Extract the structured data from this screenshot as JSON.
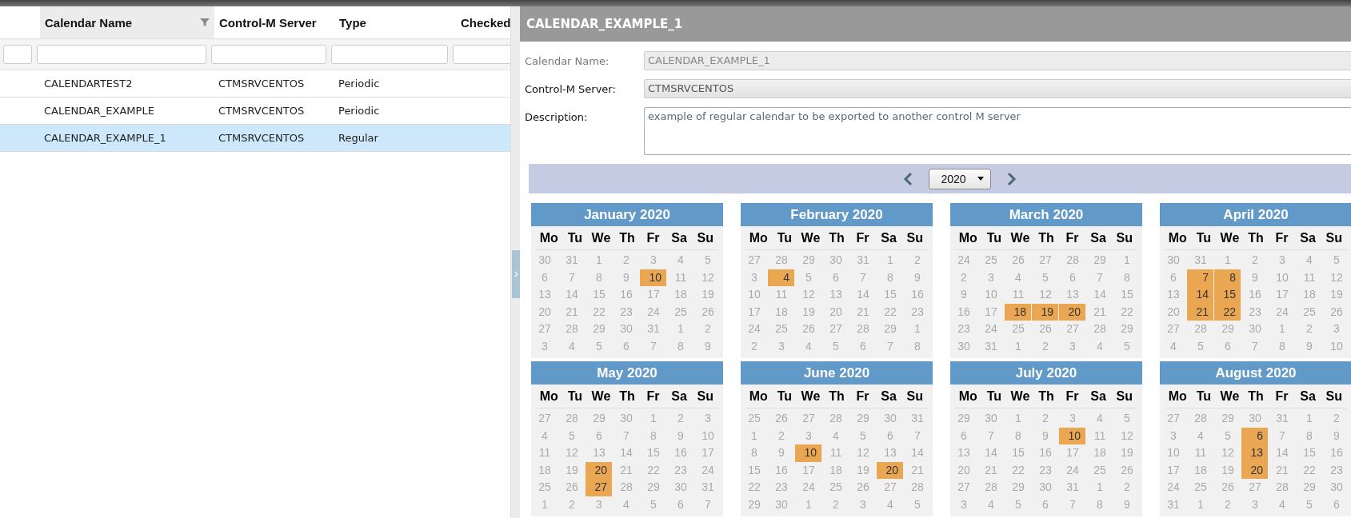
{
  "table": {
    "columns": [
      {
        "label": "Calendar Name",
        "active": true
      },
      {
        "label": "Control-M Server",
        "active": false
      },
      {
        "label": "Type",
        "active": false
      },
      {
        "label": "Checked",
        "active": false
      }
    ],
    "rows": [
      {
        "cells": [
          "CALENDARTEST2",
          "CTMSRVCENTOS",
          "Periodic"
        ],
        "selected": false
      },
      {
        "cells": [
          "CALENDAR_EXAMPLE",
          "CTMSRVCENTOS",
          "Periodic"
        ],
        "selected": false
      },
      {
        "cells": [
          "CALENDAR_EXAMPLE_1",
          "CTMSRVCENTOS",
          "Regular"
        ],
        "selected": true
      }
    ]
  },
  "details": {
    "title": "CALENDAR_EXAMPLE_1",
    "fields": [
      {
        "label": "Calendar Name:",
        "value": "CALENDAR_EXAMPLE_1",
        "kind": "disabled"
      },
      {
        "label": "Control-M Server:",
        "value": "CTMSRVCENTOS",
        "kind": "readonly"
      },
      {
        "label": "Description:",
        "value": "example of regular calendar to be exported to another control M server",
        "kind": "textarea"
      }
    ],
    "year": "2020",
    "months": [
      {
        "title": "January 2020",
        "weekdays": [
          "Mo",
          "Tu",
          "We",
          "Th",
          "Fr",
          "Sa",
          "Su"
        ],
        "days": [
          {
            "day": "30",
            "selected": false
          },
          {
            "day": "31",
            "selected": false
          },
          {
            "day": "1",
            "selected": false
          },
          {
            "day": "2",
            "selected": false
          },
          {
            "day": "3",
            "selected": false
          },
          {
            "day": "4",
            "selected": false
          },
          {
            "day": "5",
            "selected": false
          },
          {
            "day": "6",
            "selected": false
          },
          {
            "day": "7",
            "selected": false
          },
          {
            "day": "8",
            "selected": false
          },
          {
            "day": "9",
            "selected": false
          },
          {
            "day": "10",
            "selected": true
          },
          {
            "day": "11",
            "selected": false
          },
          {
            "day": "12",
            "selected": false
          },
          {
            "day": "13",
            "selected": false
          },
          {
            "day": "14",
            "selected": false
          },
          {
            "day": "15",
            "selected": false
          },
          {
            "day": "16",
            "selected": false
          },
          {
            "day": "17",
            "selected": false
          },
          {
            "day": "18",
            "selected": false
          },
          {
            "day": "19",
            "selected": false
          },
          {
            "day": "20",
            "selected": false
          },
          {
            "day": "21",
            "selected": false
          },
          {
            "day": "22",
            "selected": false
          },
          {
            "day": "23",
            "selected": false
          },
          {
            "day": "24",
            "selected": false
          },
          {
            "day": "25",
            "selected": false
          },
          {
            "day": "26",
            "selected": false
          },
          {
            "day": "27",
            "selected": false
          },
          {
            "day": "28",
            "selected": false
          },
          {
            "day": "29",
            "selected": false
          },
          {
            "day": "30",
            "selected": false
          },
          {
            "day": "31",
            "selected": false
          },
          {
            "day": "1",
            "selected": false
          },
          {
            "day": "2",
            "selected": false
          },
          {
            "day": "3",
            "selected": false
          },
          {
            "day": "4",
            "selected": false
          },
          {
            "day": "5",
            "selected": false
          },
          {
            "day": "6",
            "selected": false
          },
          {
            "day": "7",
            "selected": false
          },
          {
            "day": "8",
            "selected": false
          },
          {
            "day": "9",
            "selected": false
          }
        ]
      },
      {
        "title": "February 2020",
        "weekdays": [
          "Mo",
          "Tu",
          "We",
          "Th",
          "Fr",
          "Sa",
          "Su"
        ],
        "days": [
          {
            "day": "27",
            "selected": false
          },
          {
            "day": "28",
            "selected": false
          },
          {
            "day": "29",
            "selected": false
          },
          {
            "day": "30",
            "selected": false
          },
          {
            "day": "31",
            "selected": false
          },
          {
            "day": "1",
            "selected": false
          },
          {
            "day": "2",
            "selected": false
          },
          {
            "day": "3",
            "selected": false
          },
          {
            "day": "4",
            "selected": true
          },
          {
            "day": "5",
            "selected": false
          },
          {
            "day": "6",
            "selected": false
          },
          {
            "day": "7",
            "selected": false
          },
          {
            "day": "8",
            "selected": false
          },
          {
            "day": "9",
            "selected": false
          },
          {
            "day": "10",
            "selected": false
          },
          {
            "day": "11",
            "selected": false
          },
          {
            "day": "12",
            "selected": false
          },
          {
            "day": "13",
            "selected": false
          },
          {
            "day": "14",
            "selected": false
          },
          {
            "day": "15",
            "selected": false
          },
          {
            "day": "16",
            "selected": false
          },
          {
            "day": "17",
            "selected": false
          },
          {
            "day": "18",
            "selected": false
          },
          {
            "day": "19",
            "selected": false
          },
          {
            "day": "20",
            "selected": false
          },
          {
            "day": "21",
            "selected": false
          },
          {
            "day": "22",
            "selected": false
          },
          {
            "day": "23",
            "selected": false
          },
          {
            "day": "24",
            "selected": false
          },
          {
            "day": "25",
            "selected": false
          },
          {
            "day": "26",
            "selected": false
          },
          {
            "day": "27",
            "selected": false
          },
          {
            "day": "28",
            "selected": false
          },
          {
            "day": "29",
            "selected": false
          },
          {
            "day": "1",
            "selected": false
          },
          {
            "day": "2",
            "selected": false
          },
          {
            "day": "3",
            "selected": false
          },
          {
            "day": "4",
            "selected": false
          },
          {
            "day": "5",
            "selected": false
          },
          {
            "day": "6",
            "selected": false
          },
          {
            "day": "7",
            "selected": false
          },
          {
            "day": "8",
            "selected": false
          }
        ]
      },
      {
        "title": "March 2020",
        "weekdays": [
          "Mo",
          "Tu",
          "We",
          "Th",
          "Fr",
          "Sa",
          "Su"
        ],
        "days": [
          {
            "day": "24",
            "selected": false
          },
          {
            "day": "25",
            "selected": false
          },
          {
            "day": "26",
            "selected": false
          },
          {
            "day": "27",
            "selected": false
          },
          {
            "day": "28",
            "selected": false
          },
          {
            "day": "29",
            "selected": false
          },
          {
            "day": "1",
            "selected": false
          },
          {
            "day": "2",
            "selected": false
          },
          {
            "day": "3",
            "selected": false
          },
          {
            "day": "4",
            "selected": false
          },
          {
            "day": "5",
            "selected": false
          },
          {
            "day": "6",
            "selected": false
          },
          {
            "day": "7",
            "selected": false
          },
          {
            "day": "8",
            "selected": false
          },
          {
            "day": "9",
            "selected": false
          },
          {
            "day": "10",
            "selected": false
          },
          {
            "day": "11",
            "selected": false
          },
          {
            "day": "12",
            "selected": false
          },
          {
            "day": "13",
            "selected": false
          },
          {
            "day": "14",
            "selected": false
          },
          {
            "day": "15",
            "selected": false
          },
          {
            "day": "16",
            "selected": false
          },
          {
            "day": "17",
            "selected": false
          },
          {
            "day": "18",
            "selected": true
          },
          {
            "day": "19",
            "selected": true
          },
          {
            "day": "20",
            "selected": true
          },
          {
            "day": "21",
            "selected": false
          },
          {
            "day": "22",
            "selected": false
          },
          {
            "day": "23",
            "selected": false
          },
          {
            "day": "24",
            "selected": false
          },
          {
            "day": "25",
            "selected": false
          },
          {
            "day": "26",
            "selected": false
          },
          {
            "day": "27",
            "selected": false
          },
          {
            "day": "28",
            "selected": false
          },
          {
            "day": "29",
            "selected": false
          },
          {
            "day": "30",
            "selected": false
          },
          {
            "day": "31",
            "selected": false
          },
          {
            "day": "1",
            "selected": false
          },
          {
            "day": "2",
            "selected": false
          },
          {
            "day": "3",
            "selected": false
          },
          {
            "day": "4",
            "selected": false
          },
          {
            "day": "5",
            "selected": false
          }
        ]
      },
      {
        "title": "April 2020",
        "weekdays": [
          "Mo",
          "Tu",
          "We",
          "Th",
          "Fr",
          "Sa",
          "Su"
        ],
        "days": [
          {
            "day": "30",
            "selected": false
          },
          {
            "day": "31",
            "selected": false
          },
          {
            "day": "1",
            "selected": false
          },
          {
            "day": "2",
            "selected": false
          },
          {
            "day": "3",
            "selected": false
          },
          {
            "day": "4",
            "selected": false
          },
          {
            "day": "5",
            "selected": false
          },
          {
            "day": "6",
            "selected": false
          },
          {
            "day": "7",
            "selected": true
          },
          {
            "day": "8",
            "selected": true
          },
          {
            "day": "9",
            "selected": false
          },
          {
            "day": "10",
            "selected": false
          },
          {
            "day": "11",
            "selected": false
          },
          {
            "day": "12",
            "selected": false
          },
          {
            "day": "13",
            "selected": false
          },
          {
            "day": "14",
            "selected": true
          },
          {
            "day": "15",
            "selected": true
          },
          {
            "day": "16",
            "selected": false
          },
          {
            "day": "17",
            "selected": false
          },
          {
            "day": "18",
            "selected": false
          },
          {
            "day": "19",
            "selected": false
          },
          {
            "day": "20",
            "selected": false
          },
          {
            "day": "21",
            "selected": true
          },
          {
            "day": "22",
            "selected": true
          },
          {
            "day": "23",
            "selected": false
          },
          {
            "day": "24",
            "selected": false
          },
          {
            "day": "25",
            "selected": false
          },
          {
            "day": "26",
            "selected": false
          },
          {
            "day": "27",
            "selected": false
          },
          {
            "day": "28",
            "selected": false
          },
          {
            "day": "29",
            "selected": false
          },
          {
            "day": "30",
            "selected": false
          },
          {
            "day": "1",
            "selected": false
          },
          {
            "day": "2",
            "selected": false
          },
          {
            "day": "3",
            "selected": false
          },
          {
            "day": "4",
            "selected": false
          },
          {
            "day": "5",
            "selected": false
          },
          {
            "day": "6",
            "selected": false
          },
          {
            "day": "7",
            "selected": false
          },
          {
            "day": "8",
            "selected": false
          },
          {
            "day": "9",
            "selected": false
          },
          {
            "day": "10",
            "selected": false
          }
        ]
      },
      {
        "title": "May 2020",
        "weekdays": [
          "Mo",
          "Tu",
          "We",
          "Th",
          "Fr",
          "Sa",
          "Su"
        ],
        "days": [
          {
            "day": "27",
            "selected": false
          },
          {
            "day": "28",
            "selected": false
          },
          {
            "day": "29",
            "selected": false
          },
          {
            "day": "30",
            "selected": false
          },
          {
            "day": "1",
            "selected": false
          },
          {
            "day": "2",
            "selected": false
          },
          {
            "day": "3",
            "selected": false
          },
          {
            "day": "4",
            "selected": false
          },
          {
            "day": "5",
            "selected": false
          },
          {
            "day": "6",
            "selected": false
          },
          {
            "day": "7",
            "selected": false
          },
          {
            "day": "8",
            "selected": false
          },
          {
            "day": "9",
            "selected": false
          },
          {
            "day": "10",
            "selected": false
          },
          {
            "day": "11",
            "selected": false
          },
          {
            "day": "12",
            "selected": false
          },
          {
            "day": "13",
            "selected": false
          },
          {
            "day": "14",
            "selected": false
          },
          {
            "day": "15",
            "selected": false
          },
          {
            "day": "16",
            "selected": false
          },
          {
            "day": "17",
            "selected": false
          },
          {
            "day": "18",
            "selected": false
          },
          {
            "day": "19",
            "selected": false
          },
          {
            "day": "20",
            "selected": true
          },
          {
            "day": "21",
            "selected": false
          },
          {
            "day": "22",
            "selected": false
          },
          {
            "day": "23",
            "selected": false
          },
          {
            "day": "24",
            "selected": false
          },
          {
            "day": "25",
            "selected": false
          },
          {
            "day": "26",
            "selected": false
          },
          {
            "day": "27",
            "selected": true
          },
          {
            "day": "28",
            "selected": false
          },
          {
            "day": "29",
            "selected": false
          },
          {
            "day": "30",
            "selected": false
          },
          {
            "day": "31",
            "selected": false
          },
          {
            "day": "1",
            "selected": false
          },
          {
            "day": "2",
            "selected": false
          },
          {
            "day": "3",
            "selected": false
          },
          {
            "day": "4",
            "selected": false
          },
          {
            "day": "5",
            "selected": false
          },
          {
            "day": "6",
            "selected": false
          },
          {
            "day": "7",
            "selected": false
          }
        ]
      },
      {
        "title": "June 2020",
        "weekdays": [
          "Mo",
          "Tu",
          "We",
          "Th",
          "Fr",
          "Sa",
          "Su"
        ],
        "days": [
          {
            "day": "25",
            "selected": false
          },
          {
            "day": "26",
            "selected": false
          },
          {
            "day": "27",
            "selected": false
          },
          {
            "day": "28",
            "selected": false
          },
          {
            "day": "29",
            "selected": false
          },
          {
            "day": "30",
            "selected": false
          },
          {
            "day": "31",
            "selected": false
          },
          {
            "day": "1",
            "selected": false
          },
          {
            "day": "2",
            "selected": false
          },
          {
            "day": "3",
            "selected": false
          },
          {
            "day": "4",
            "selected": false
          },
          {
            "day": "5",
            "selected": false
          },
          {
            "day": "6",
            "selected": false
          },
          {
            "day": "7",
            "selected": false
          },
          {
            "day": "8",
            "selected": false
          },
          {
            "day": "9",
            "selected": false
          },
          {
            "day": "10",
            "selected": true
          },
          {
            "day": "11",
            "selected": false
          },
          {
            "day": "12",
            "selected": false
          },
          {
            "day": "13",
            "selected": false
          },
          {
            "day": "14",
            "selected": false
          },
          {
            "day": "15",
            "selected": false
          },
          {
            "day": "16",
            "selected": false
          },
          {
            "day": "17",
            "selected": false
          },
          {
            "day": "18",
            "selected": false
          },
          {
            "day": "19",
            "selected": false
          },
          {
            "day": "20",
            "selected": true
          },
          {
            "day": "21",
            "selected": false
          },
          {
            "day": "22",
            "selected": false
          },
          {
            "day": "23",
            "selected": false
          },
          {
            "day": "24",
            "selected": false
          },
          {
            "day": "25",
            "selected": false
          },
          {
            "day": "26",
            "selected": false
          },
          {
            "day": "27",
            "selected": false
          },
          {
            "day": "28",
            "selected": false
          },
          {
            "day": "29",
            "selected": false
          },
          {
            "day": "30",
            "selected": false
          },
          {
            "day": "1",
            "selected": false
          },
          {
            "day": "2",
            "selected": false
          },
          {
            "day": "3",
            "selected": false
          },
          {
            "day": "4",
            "selected": false
          },
          {
            "day": "5",
            "selected": false
          }
        ]
      },
      {
        "title": "July 2020",
        "weekdays": [
          "Mo",
          "Tu",
          "We",
          "Th",
          "Fr",
          "Sa",
          "Su"
        ],
        "days": [
          {
            "day": "29",
            "selected": false
          },
          {
            "day": "30",
            "selected": false
          },
          {
            "day": "1",
            "selected": false
          },
          {
            "day": "2",
            "selected": false
          },
          {
            "day": "3",
            "selected": false
          },
          {
            "day": "4",
            "selected": false
          },
          {
            "day": "5",
            "selected": false
          },
          {
            "day": "6",
            "selected": false
          },
          {
            "day": "7",
            "selected": false
          },
          {
            "day": "8",
            "selected": false
          },
          {
            "day": "9",
            "selected": false
          },
          {
            "day": "10",
            "selected": true
          },
          {
            "day": "11",
            "selected": false
          },
          {
            "day": "12",
            "selected": false
          },
          {
            "day": "13",
            "selected": false
          },
          {
            "day": "14",
            "selected": false
          },
          {
            "day": "15",
            "selected": false
          },
          {
            "day": "16",
            "selected": false
          },
          {
            "day": "17",
            "selected": false
          },
          {
            "day": "18",
            "selected": false
          },
          {
            "day": "19",
            "selected": false
          },
          {
            "day": "20",
            "selected": false
          },
          {
            "day": "21",
            "selected": false
          },
          {
            "day": "22",
            "selected": false
          },
          {
            "day": "23",
            "selected": false
          },
          {
            "day": "24",
            "selected": false
          },
          {
            "day": "25",
            "selected": false
          },
          {
            "day": "26",
            "selected": false
          },
          {
            "day": "27",
            "selected": false
          },
          {
            "day": "28",
            "selected": false
          },
          {
            "day": "29",
            "selected": false
          },
          {
            "day": "30",
            "selected": false
          },
          {
            "day": "31",
            "selected": false
          },
          {
            "day": "1",
            "selected": false
          },
          {
            "day": "2",
            "selected": false
          },
          {
            "day": "3",
            "selected": false
          },
          {
            "day": "4",
            "selected": false
          },
          {
            "day": "5",
            "selected": false
          },
          {
            "day": "6",
            "selected": false
          },
          {
            "day": "7",
            "selected": false
          },
          {
            "day": "8",
            "selected": false
          },
          {
            "day": "9",
            "selected": false
          }
        ]
      },
      {
        "title": "August 2020",
        "weekdays": [
          "Mo",
          "Tu",
          "We",
          "Th",
          "Fr",
          "Sa",
          "Su"
        ],
        "days": [
          {
            "day": "27",
            "selected": false
          },
          {
            "day": "28",
            "selected": false
          },
          {
            "day": "29",
            "selected": false
          },
          {
            "day": "30",
            "selected": false
          },
          {
            "day": "31",
            "selected": false
          },
          {
            "day": "1",
            "selected": false
          },
          {
            "day": "2",
            "selected": false
          },
          {
            "day": "3",
            "selected": false
          },
          {
            "day": "4",
            "selected": false
          },
          {
            "day": "5",
            "selected": false
          },
          {
            "day": "6",
            "selected": true
          },
          {
            "day": "7",
            "selected": false
          },
          {
            "day": "8",
            "selected": false
          },
          {
            "day": "9",
            "selected": false
          },
          {
            "day": "10",
            "selected": false
          },
          {
            "day": "11",
            "selected": false
          },
          {
            "day": "12",
            "selected": false
          },
          {
            "day": "13",
            "selected": true
          },
          {
            "day": "14",
            "selected": false
          },
          {
            "day": "15",
            "selected": false
          },
          {
            "day": "16",
            "selected": false
          },
          {
            "day": "17",
            "selected": false
          },
          {
            "day": "18",
            "selected": false
          },
          {
            "day": "19",
            "selected": false
          },
          {
            "day": "20",
            "selected": true
          },
          {
            "day": "21",
            "selected": false
          },
          {
            "day": "22",
            "selected": false
          },
          {
            "day": "23",
            "selected": false
          },
          {
            "day": "24",
            "selected": false
          },
          {
            "day": "25",
            "selected": false
          },
          {
            "day": "26",
            "selected": false
          },
          {
            "day": "27",
            "selected": false
          },
          {
            "day": "28",
            "selected": false
          },
          {
            "day": "29",
            "selected": false
          },
          {
            "day": "30",
            "selected": false
          },
          {
            "day": "31",
            "selected": false
          },
          {
            "day": "1",
            "selected": false
          },
          {
            "day": "2",
            "selected": false
          },
          {
            "day": "3",
            "selected": false
          },
          {
            "day": "4",
            "selected": false
          },
          {
            "day": "5",
            "selected": false
          },
          {
            "day": "6",
            "selected": false
          }
        ]
      }
    ]
  }
}
